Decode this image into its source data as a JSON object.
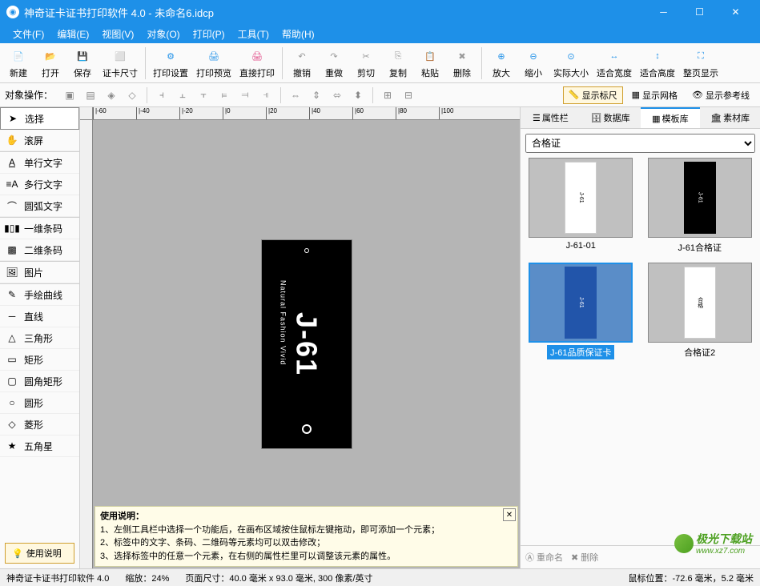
{
  "window": {
    "title": "神奇证卡证书打印软件 4.0 - 未命名6.idcp"
  },
  "menu": {
    "file": "文件(F)",
    "edit": "编辑(E)",
    "view": "视图(V)",
    "object": "对象(O)",
    "print": "打印(P)",
    "tool": "工具(T)",
    "help": "帮助(H)"
  },
  "toolbar": {
    "new": "新建",
    "open": "打开",
    "save": "保存",
    "cardsize": "证卡尺寸",
    "printset": "打印设置",
    "preview": "打印预览",
    "directprint": "直接打印",
    "undo": "撤销",
    "redo": "重做",
    "cut": "剪切",
    "copy": "复制",
    "paste": "粘贴",
    "delete": "删除",
    "zoomin": "放大",
    "zoomout": "缩小",
    "actualsize": "实际大小",
    "fitwidth": "适合宽度",
    "fitheight": "适合高度",
    "fitpage": "整页显示"
  },
  "optionbar": {
    "label": "对象操作：",
    "showruler": "显示标尺",
    "showgrid": "显示网格",
    "showguide": "显示参考线"
  },
  "lefttools": {
    "select": "选择",
    "pan": "滚屏",
    "text1": "单行文字",
    "text2": "多行文字",
    "arctext": "圆弧文字",
    "barcode1": "一维条码",
    "barcode2": "二维条码",
    "image": "图片",
    "freehand": "手绘曲线",
    "line": "直线",
    "triangle": "三角形",
    "rect": "矩形",
    "roundrect": "圆角矩形",
    "circle": "圆形",
    "diamond": "菱形",
    "star": "五角星",
    "instructions": "使用说明"
  },
  "ruler": {
    "ticks": [
      "|-60",
      "|-40",
      "|-20",
      "|0",
      "|20",
      "|40",
      "|60",
      "|80",
      "|100"
    ]
  },
  "card": {
    "main": "J-61",
    "sub": "Natural Fashion Vivid"
  },
  "instructions": {
    "title": "使用说明：",
    "line1": "1、左侧工具栏中选择一个功能后，在画布区域按住鼠标左键拖动，即可添加一个元素；",
    "line2": "2、标签中的文字、条码、二维码等元素均可以双击修改；",
    "line3": "3、选择标签中的任意一个元素，在右侧的属性栏里可以调整该元素的属性。"
  },
  "righttabs": {
    "props": "属性栏",
    "data": "数据库",
    "templates": "模板库",
    "materials": "素材库"
  },
  "rightpanel": {
    "category": "合格证",
    "t1": "J-61-01",
    "t2": "J-61合格证",
    "t3": "J-61品质保证卡",
    "t4": "合格证2",
    "rename": "重命名",
    "delete": "删除"
  },
  "status": {
    "app": "神奇证卡证书打印软件 4.0",
    "zoom": "缩放：24%",
    "pagesize": "页面尺寸：40.0 毫米 x 93.0 毫米, 300 像素/英寸",
    "mousepos": "鼠标位置：-72.6 毫米，5.2 毫米"
  },
  "watermark": {
    "text1": "极光下载站",
    "text2": "www.xz7.com"
  }
}
